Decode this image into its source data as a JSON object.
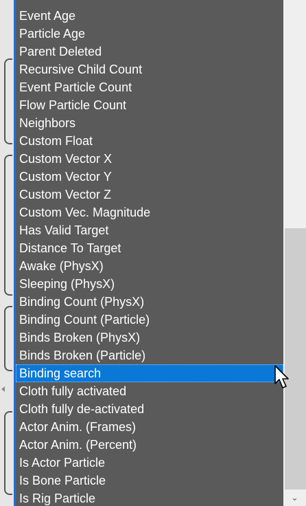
{
  "list": {
    "items": [
      "Event Age",
      "Particle Age",
      "Parent Deleted",
      "Recursive Child Count",
      "Event Particle Count",
      "Flow Particle Count",
      "Neighbors",
      "Custom Float",
      "Custom Vector X",
      "Custom Vector Y",
      "Custom Vector Z",
      "Custom Vec. Magnitude",
      "Has Valid Target",
      "Distance To Target",
      "Awake (PhysX)",
      "Sleeping (PhysX)",
      "Binding Count (PhysX)",
      "Binding Count (Particle)",
      "Binds Broken (PhysX)",
      "Binds Broken (Particle)",
      "Binding search",
      "Cloth fully activated",
      "Cloth fully de-activated",
      "Actor Anim. (Frames)",
      "Actor Anim. (Percent)",
      "Is Actor Particle",
      "Is Bone Particle",
      "Is Rig Particle"
    ],
    "selected_index": 20
  },
  "scrollbar": {
    "down_arrow_icon": "chevron-down-icon",
    "down_glyph": "⌄"
  },
  "colors": {
    "list_bg": "#5a5a5a",
    "text": "#ffffff",
    "selection": "#0a78d7",
    "accent_border": "#1f6fd6"
  },
  "cursor_icon": "mouse-pointer-icon"
}
